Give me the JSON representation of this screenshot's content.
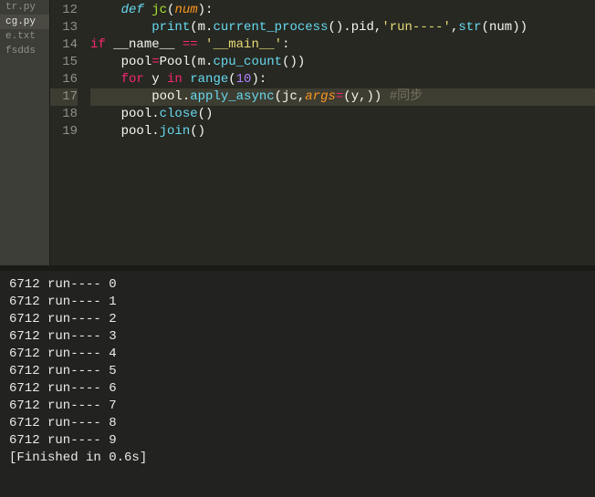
{
  "sidebar": {
    "items": [
      {
        "label": "tr.py"
      },
      {
        "label": "cg.py"
      },
      {
        "label": "e.txt"
      },
      {
        "label": "fsdds"
      }
    ],
    "active_index": 1
  },
  "editor": {
    "first_line": 12,
    "current_line": 17,
    "lines": [
      {
        "n": 12,
        "tokens": [
          {
            "t": "def ",
            "c": "def"
          },
          {
            "t": "jc",
            "c": "fn"
          },
          {
            "t": "(",
            "c": "punc"
          },
          {
            "t": "num",
            "c": "param"
          },
          {
            "t": "):",
            "c": "punc"
          }
        ],
        "indent": 0
      },
      {
        "n": 13,
        "tokens": [
          {
            "t": "print",
            "c": "call"
          },
          {
            "t": "(",
            "c": "punc"
          },
          {
            "t": "m",
            "c": "var"
          },
          {
            "t": ".",
            "c": "punc"
          },
          {
            "t": "current_process",
            "c": "call"
          },
          {
            "t": "().",
            "c": "punc"
          },
          {
            "t": "pid",
            "c": "var"
          },
          {
            "t": ",",
            "c": "punc"
          },
          {
            "t": "'run----'",
            "c": "str"
          },
          {
            "t": ",",
            "c": "punc"
          },
          {
            "t": "str",
            "c": "call"
          },
          {
            "t": "(",
            "c": "punc"
          },
          {
            "t": "num",
            "c": "var"
          },
          {
            "t": "))",
            "c": "punc"
          }
        ],
        "indent": 1
      },
      {
        "n": 14,
        "tokens": [
          {
            "t": "if ",
            "c": "kw2"
          },
          {
            "t": "__name__",
            "c": "var"
          },
          {
            "t": " == ",
            "c": "op"
          },
          {
            "t": "'__main__'",
            "c": "str"
          },
          {
            "t": ":",
            "c": "punc"
          }
        ],
        "indent": -1
      },
      {
        "n": 15,
        "tokens": [
          {
            "t": "pool",
            "c": "var"
          },
          {
            "t": "=",
            "c": "op"
          },
          {
            "t": "Pool",
            "c": "var"
          },
          {
            "t": "(",
            "c": "punc"
          },
          {
            "t": "m",
            "c": "var"
          },
          {
            "t": ".",
            "c": "punc"
          },
          {
            "t": "cpu_count",
            "c": "call"
          },
          {
            "t": "())",
            "c": "punc"
          }
        ],
        "indent": 0
      },
      {
        "n": 16,
        "tokens": [
          {
            "t": "for ",
            "c": "kw2"
          },
          {
            "t": "y",
            "c": "var"
          },
          {
            "t": " in ",
            "c": "kw2"
          },
          {
            "t": "range",
            "c": "call"
          },
          {
            "t": "(",
            "c": "punc"
          },
          {
            "t": "10",
            "c": "num"
          },
          {
            "t": "):",
            "c": "punc"
          }
        ],
        "indent": 0
      },
      {
        "n": 17,
        "tokens": [
          {
            "t": "pool",
            "c": "var"
          },
          {
            "t": ".",
            "c": "punc"
          },
          {
            "t": "apply_async",
            "c": "call"
          },
          {
            "t": "(",
            "c": "punc"
          },
          {
            "t": "jc",
            "c": "var"
          },
          {
            "t": ",",
            "c": "punc"
          },
          {
            "t": "args",
            "c": "param"
          },
          {
            "t": "=",
            "c": "op"
          },
          {
            "t": "(",
            "c": "punc"
          },
          {
            "t": "y",
            "c": "var"
          },
          {
            "t": ",))",
            "c": "punc"
          },
          {
            "t": " #同步",
            "c": "comment"
          }
        ],
        "indent": 1
      },
      {
        "n": 18,
        "tokens": [
          {
            "t": "pool",
            "c": "var"
          },
          {
            "t": ".",
            "c": "punc"
          },
          {
            "t": "close",
            "c": "call"
          },
          {
            "t": "()",
            "c": "punc"
          }
        ],
        "indent": 0
      },
      {
        "n": 19,
        "tokens": [
          {
            "t": "pool",
            "c": "var"
          },
          {
            "t": ".",
            "c": "punc"
          },
          {
            "t": "join",
            "c": "call"
          },
          {
            "t": "()",
            "c": "punc"
          }
        ],
        "indent": 0
      }
    ]
  },
  "console": {
    "lines": [
      "6712 run---- 0",
      "6712 run---- 1",
      "6712 run---- 2",
      "6712 run---- 3",
      "6712 run---- 4",
      "6712 run---- 5",
      "6712 run---- 6",
      "6712 run---- 7",
      "6712 run---- 8",
      "6712 run---- 9",
      "[Finished in 0.6s]"
    ]
  }
}
